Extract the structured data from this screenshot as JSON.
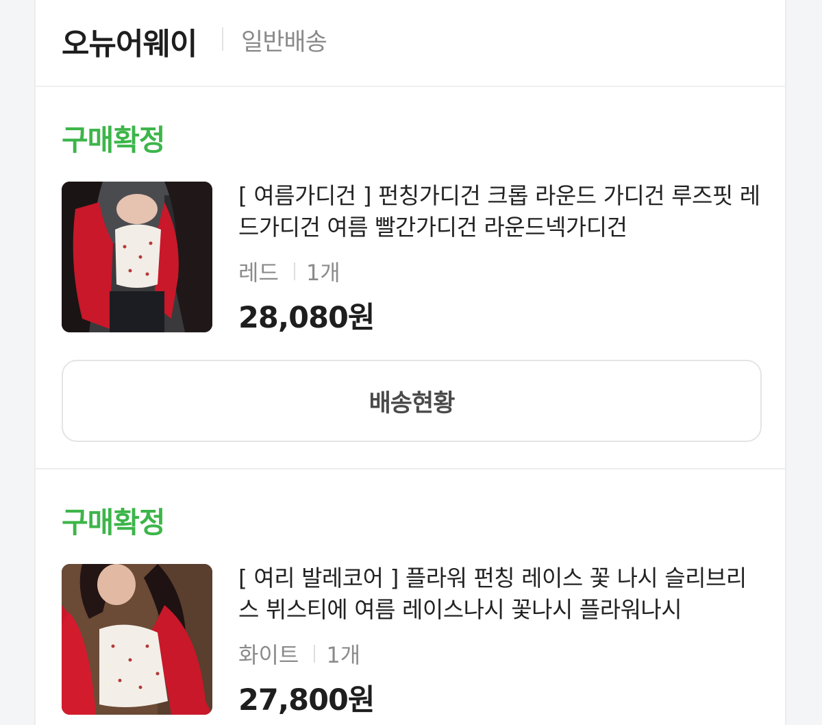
{
  "store": {
    "name": "오뉴어웨이",
    "delivery_type": "일반배송"
  },
  "orders": [
    {
      "status": "구매확정",
      "title": "[ 여름가디건 ] 펀칭가디건 크롭 라운드 가디건 루즈핏 레드가디건 여름 빨간가디건 라운드넥가디건",
      "option": "레드",
      "quantity": "1개",
      "price": "28,080원",
      "button_label": "배송현황",
      "colors": {
        "status": "#3db54a"
      }
    },
    {
      "status": "구매확정",
      "title": "[ 여리 발레코어 ] 플라워 펀칭 레이스 꽃 나시 슬리브리스 뷔스티에 여름 레이스나시 꽃나시 플라워나시",
      "option": "화이트",
      "quantity": "1개",
      "price": "27,800원",
      "colors": {
        "status": "#3db54a"
      }
    }
  ]
}
